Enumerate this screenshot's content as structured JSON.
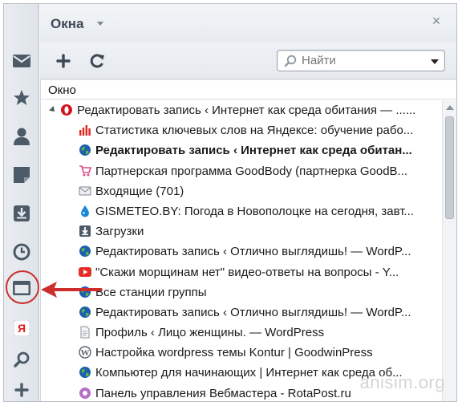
{
  "panel": {
    "title": "Окна",
    "close_glyph": "×"
  },
  "toolbar": {
    "add_icon": "plus-icon",
    "reload_icon": "reload-icon"
  },
  "search": {
    "placeholder": "Найти",
    "value": ""
  },
  "tree": {
    "column_header": "Окно",
    "parent": {
      "icon": "opera-icon",
      "label": "Редактировать запись ‹ Интернет как среда обитания — ......"
    },
    "children": [
      {
        "icon": "stats-chart-icon",
        "label": "Статистика ключевых слов на Яндексе: обучение рабо..."
      },
      {
        "icon": "globe-icon",
        "label": "Редактировать запись ‹ Интернет как среда обитан...",
        "bold": true
      },
      {
        "icon": "cart-icon",
        "label": "Партнерская программа GoodBody (партнерка GoodB..."
      },
      {
        "icon": "mail-icon",
        "label": "Входящие (701)"
      },
      {
        "icon": "drop-icon",
        "label": "GISMETEO.BY: Погода в Новополоцке на сегодня, завт..."
      },
      {
        "icon": "download-icon",
        "label": "Загрузки"
      },
      {
        "icon": "globe-icon",
        "label": "Редактировать запись ‹ Отлично выглядишь! — WordP..."
      },
      {
        "icon": "youtube-icon",
        "label": "\"Скажи морщинам нет\" видео-ответы на вопросы - Y..."
      },
      {
        "icon": "globe-icon",
        "label": "Все станции группы"
      },
      {
        "icon": "globe-icon",
        "label": "Редактировать запись ‹ Отлично выглядишь! — WordP..."
      },
      {
        "icon": "page-icon",
        "label": "Профиль ‹ Лицо женщины. — WordPress"
      },
      {
        "icon": "wordpress-icon",
        "label": "Настройка wordpress темы Kontur | GoodwinPress"
      },
      {
        "icon": "globe-icon",
        "label": "Компьютер для начинающих | Интернет как среда об..."
      },
      {
        "icon": "rotapost-icon",
        "label": "Панель управления Вебмастера - RotaPost.ru"
      }
    ]
  },
  "sidebar": {
    "items": [
      {
        "icon": "mail-icon"
      },
      {
        "icon": "star-icon"
      },
      {
        "icon": "person-icon"
      },
      {
        "icon": "note-icon"
      },
      {
        "icon": "download-icon"
      },
      {
        "icon": "clock-icon"
      },
      {
        "icon": "windows-icon",
        "active": true
      },
      {
        "icon": "yandex-icon"
      },
      {
        "icon": "search-icon"
      },
      {
        "icon": "plus-icon"
      }
    ]
  },
  "watermark": "anisim.org",
  "colors": {
    "annotation": "#cc2e2e",
    "sidebar_icon": "#4c5967"
  }
}
